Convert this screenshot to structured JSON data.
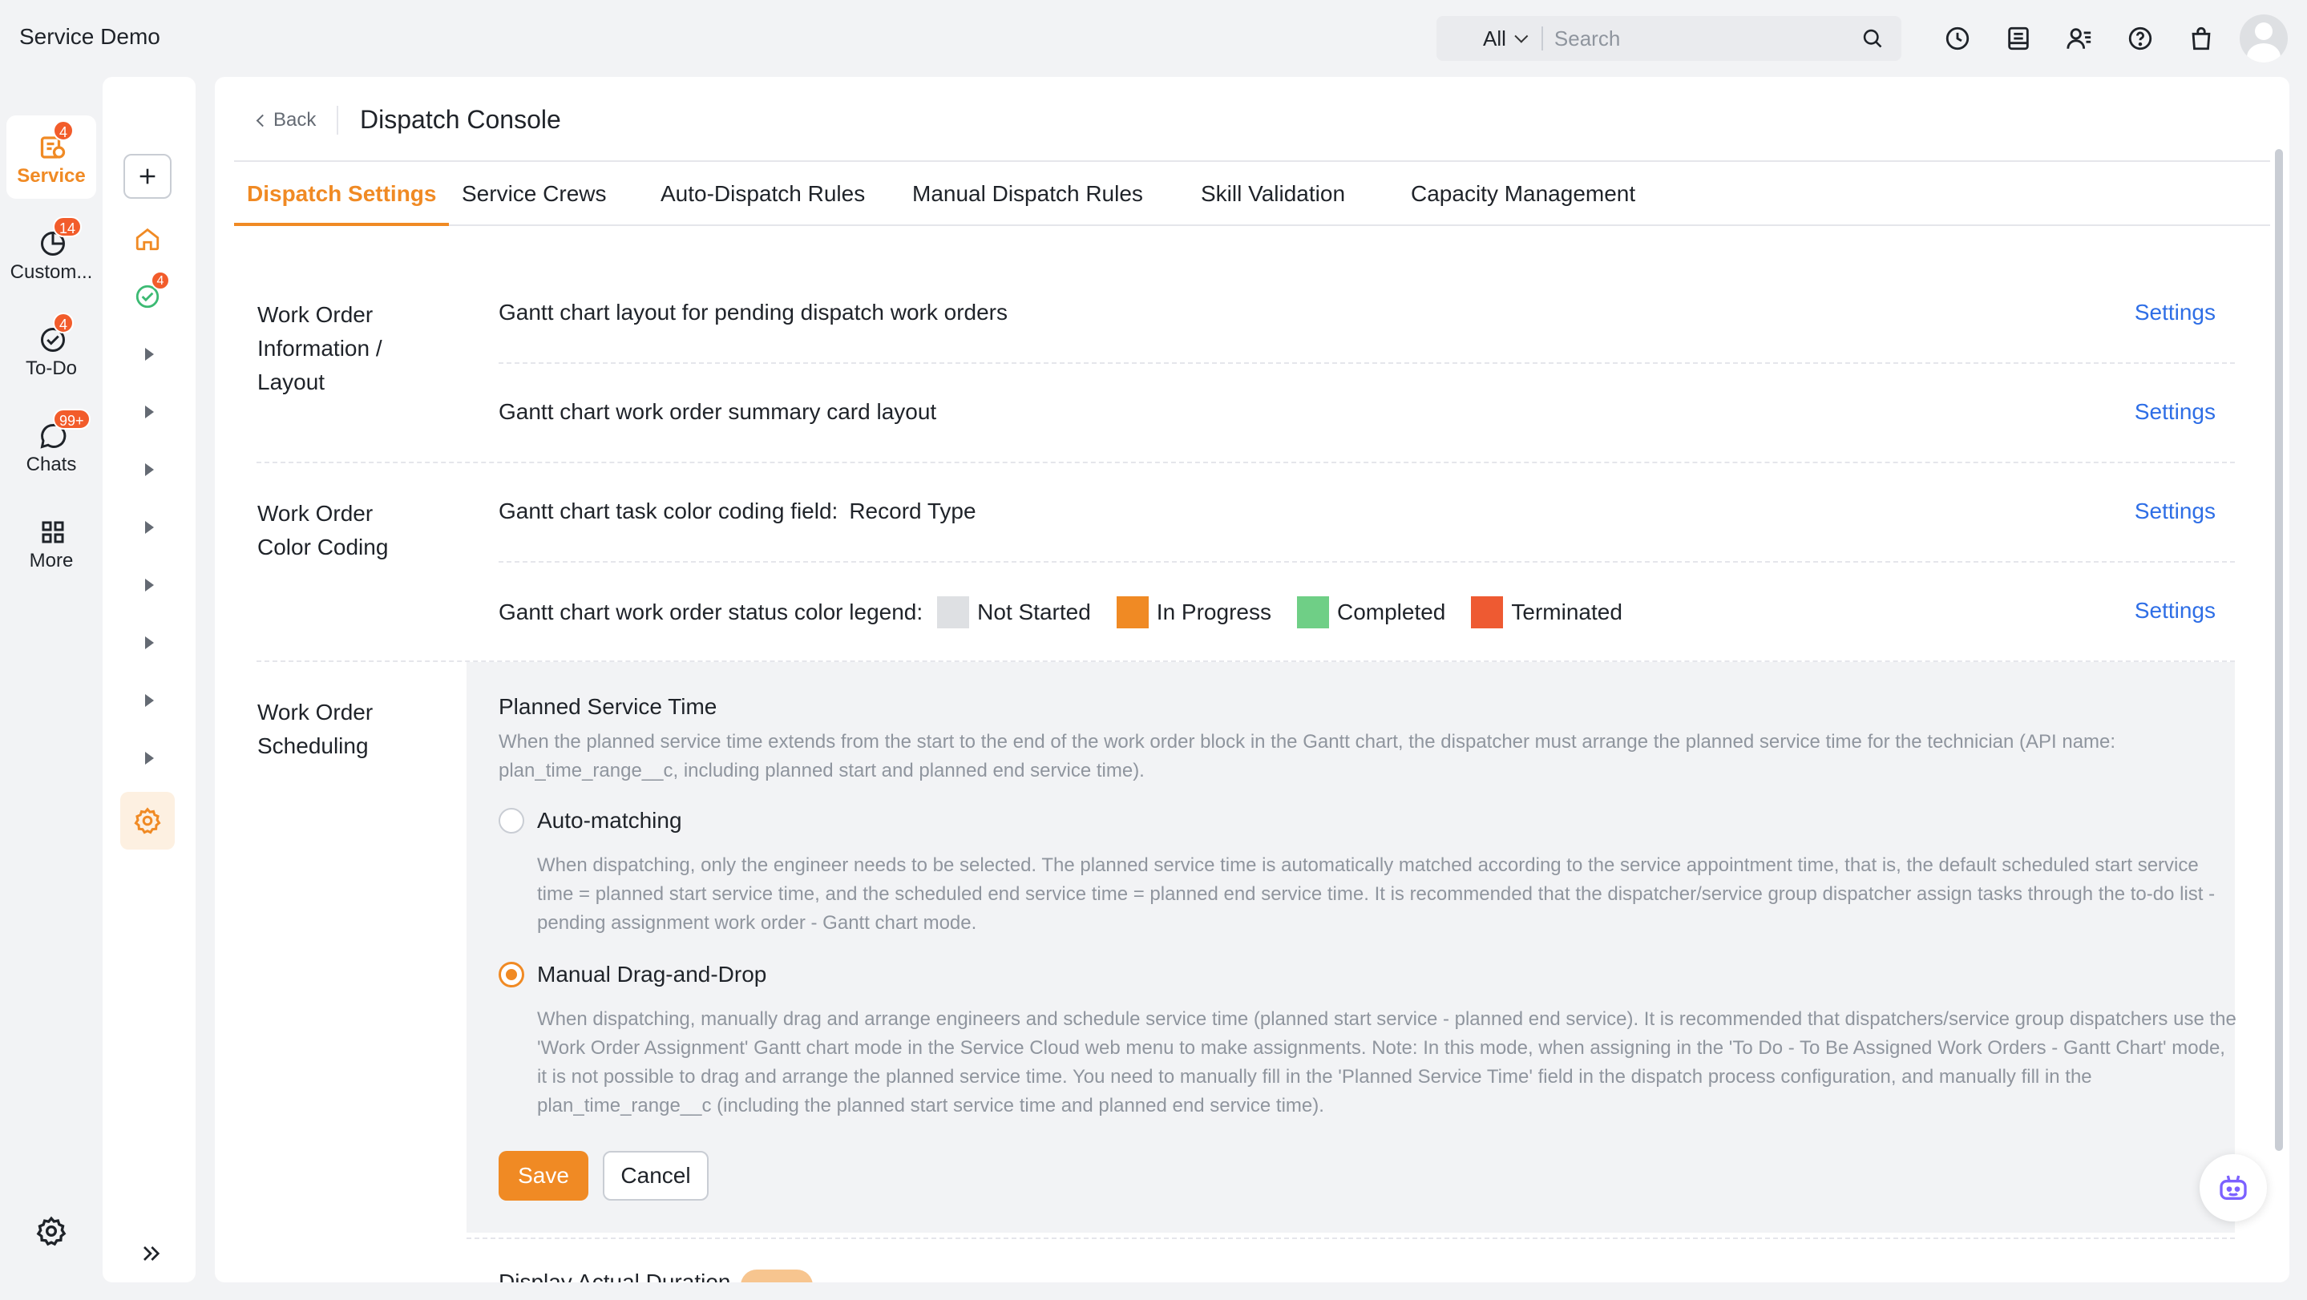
{
  "app": {
    "title": "Service Demo"
  },
  "search": {
    "scope": "All",
    "placeholder": "Search"
  },
  "nav_primary": [
    {
      "label": "Service",
      "badge": "4",
      "icon": "service-icon"
    },
    {
      "label": "Custom...",
      "badge": "14",
      "icon": "customer-icon"
    },
    {
      "label": "To-Do",
      "badge": "4",
      "icon": "todo-icon"
    },
    {
      "label": "Chats",
      "badge": "99+",
      "icon": "chat-icon"
    },
    {
      "label": "More",
      "badge": "",
      "icon": "grid-icon"
    }
  ],
  "nav_secondary": {
    "todo_badge": "4"
  },
  "header": {
    "back_label": "Back",
    "title": "Dispatch Console"
  },
  "tabs": [
    {
      "label": "Dispatch Settings"
    },
    {
      "label": "Service Crews"
    },
    {
      "label": "Auto-Dispatch Rules"
    },
    {
      "label": "Manual Dispatch Rules"
    },
    {
      "label": "Skill Validation"
    },
    {
      "label": "Capacity Management"
    }
  ],
  "sections": {
    "layout": {
      "label": "Work Order Information / Layout",
      "row1": "Gantt chart layout for pending dispatch work orders",
      "row2": "Gantt chart work order summary card layout"
    },
    "color": {
      "label": "Work Order Color Coding",
      "row1_label": "Gantt chart task color coding field:",
      "row1_value": "Record Type",
      "row2_label": "Gantt chart work order status color legend:",
      "legend": [
        {
          "label": "Not Started",
          "color": "#dee0e3"
        },
        {
          "label": "In Progress",
          "color": "#f08a24"
        },
        {
          "label": "Completed",
          "color": "#6fcf86"
        },
        {
          "label": "Terminated",
          "color": "#ee5a32"
        }
      ]
    },
    "scheduling": {
      "label": "Work Order Scheduling",
      "title": "Planned Service Time",
      "description": "When the planned service time extends from the start to the end of the work order block in the Gantt chart, the dispatcher must arrange the planned service time for the technician (API name: plan_time_range__c, including planned start and planned end service time).",
      "option1_label": "Auto-matching",
      "option1_desc": "When dispatching, only the engineer needs to be selected. The planned service time is automatically matched according to the service appointment time, that is, the default scheduled start service time = planned start service time, and the scheduled end service time = planned end service time. It is recommended that the dispatcher/service group dispatcher assign tasks through the to-do list - pending assignment work order - Gantt chart mode.",
      "option2_label": "Manual Drag-and-Drop",
      "option2_desc": "When dispatching, manually drag and arrange engineers and schedule service time (planned start service - planned end service). It is recommended that dispatchers/service group dispatchers use the 'Work Order Assignment' Gantt chart mode in the Service Cloud web menu to make assignments. Note: In this mode, when assigning in the 'To Do - To Be Assigned Work Orders - Gantt Chart' mode, it is not possible to drag and arrange the planned service time. You need to manually fill in the 'Planned Service Time' field in the dispatch process configuration, and manually fill in the plan_time_range__c (including the planned start service time and planned end service time).",
      "selected_option": "option2",
      "save_label": "Save",
      "cancel_label": "Cancel"
    }
  },
  "settings_label": "Settings",
  "partial_row": "Display Actual Duration",
  "colors": {
    "accent": "#f08a24",
    "link": "#2e6ee6",
    "badge": "#f25c2b"
  }
}
